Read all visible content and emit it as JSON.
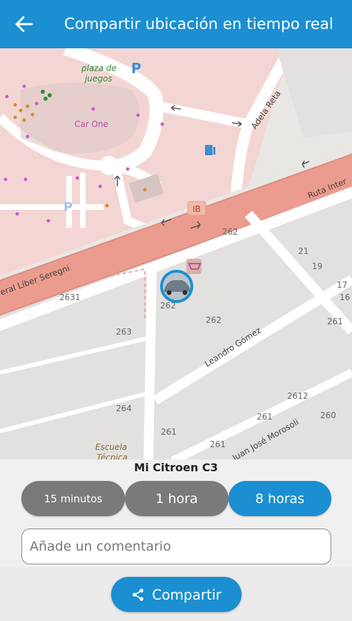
{
  "header": {
    "title": "Compartir ubicación en tiempo real",
    "back_icon": "arrow-left-icon"
  },
  "map": {
    "labels": {
      "playground": "plaza de juegos",
      "carone": "Car One",
      "adela_reta": "Adela Reta",
      "ruta_inter": "Ruta Inter",
      "general_liber": "eral Líber Seregni",
      "leandro": "Leandro Gómez",
      "juan_jose": "Juan José Morosoli",
      "escuela": "Escuela Técnica",
      "ib": "IB",
      "parking": "P"
    },
    "house_numbers": [
      "262",
      "21",
      "19",
      "17",
      "16",
      "261",
      "2631",
      "262",
      "262",
      "263",
      "264",
      "2612",
      "261",
      "260",
      "261",
      "261"
    ]
  },
  "sheet": {
    "vehicle_name": "Mi Citroen C3",
    "options": {
      "opt1": "15 minutos",
      "opt2": "1 hora",
      "opt3": "8 horas"
    },
    "selected": "8 horas",
    "comment_placeholder": "Añade un comentario",
    "share_label": "Compartir",
    "share_icon": "share-icon"
  },
  "colors": {
    "accent": "#1b8fd2",
    "inactive": "#7a7a7a",
    "map_pink": "#f3d6d3",
    "avenue": "#ec9c8e"
  }
}
